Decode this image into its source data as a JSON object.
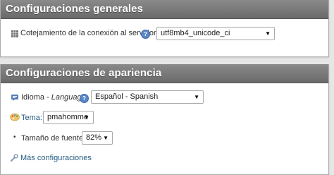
{
  "general": {
    "title": "Configuraciones generales",
    "collation_label": "Cotejamiento de la conexión al servidor",
    "collation_value": "utf8mb4_unicode_ci",
    "help_icon": "help-icon",
    "row_icon": "grid-icon"
  },
  "appearance": {
    "title": "Configuraciones de apariencia",
    "language_label": "Idioma - ",
    "language_label_italic": "Language",
    "language_value": "Español - Spanish",
    "theme_label": "Tema:",
    "theme_value": "pmahomme",
    "font_size_label": "Tamaño de fuente:",
    "font_size_value": "82%",
    "more_settings": "Más configuraciones"
  },
  "colors": {
    "header_bg": "#777777",
    "link": "#235a81",
    "background": "#e6e6e6"
  }
}
